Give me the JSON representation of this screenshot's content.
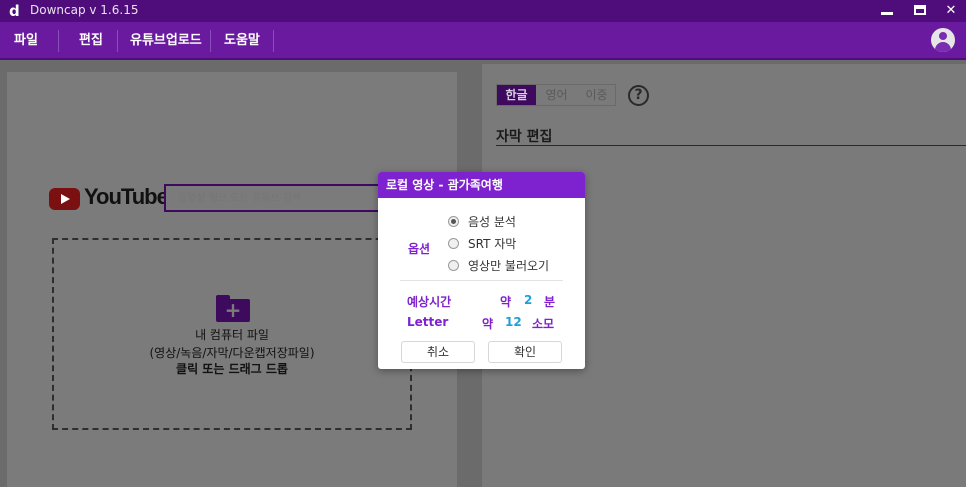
{
  "window": {
    "logo": "d",
    "title": "Downcap v 1.6.15"
  },
  "menu": [
    "파일",
    "편집",
    "유튜브업로드",
    "도움말"
  ],
  "youtube": {
    "logo_text": "YouTube",
    "search_placeholder": "동영상 링크 또는 유튜브 검색"
  },
  "dropzone": {
    "line1": "내 컴퓨터 파일",
    "line2": "(영상/녹음/자막/다운캡저장파일)",
    "line3": "클릭 또는 드래그 드롭"
  },
  "right": {
    "lang_tabs": [
      "한글",
      "영어",
      "이중"
    ],
    "active_tab": "한글",
    "section_title": "자막 편집"
  },
  "dialog": {
    "title": "로컬 영상 - 괌가족여행",
    "option_label": "옵션",
    "options": [
      "음성 분석",
      "SRT 자막",
      "영상만 불러오기"
    ],
    "selected_option": "음성 분석",
    "estimates": [
      {
        "label": "예상시간",
        "prefix": "약",
        "value": "2",
        "unit": "분"
      },
      {
        "label": "Letter",
        "prefix": "약",
        "value": "12",
        "unit": "소모"
      }
    ],
    "cancel_label": "취소",
    "confirm_label": "확인"
  },
  "colors": {
    "titlebar": "#4e0d7a",
    "menubar": "#6a1a9e",
    "accent": "#7e22cf",
    "value": "#1ea0d8"
  }
}
